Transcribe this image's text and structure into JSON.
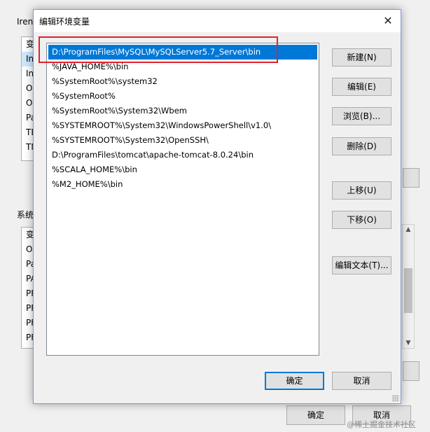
{
  "background": {
    "user_group_label": "Iren",
    "user_rows": [
      "变",
      "In",
      "In",
      "O",
      "O",
      "Pa",
      "TE",
      "TM"
    ],
    "system_group_label": "系统",
    "system_rows": [
      "变",
      "O",
      "Pa",
      "PA",
      "PF",
      "PF",
      "PF",
      "PF"
    ],
    "ok_label": "确定",
    "cancel_label": "取消"
  },
  "dialog": {
    "title": "编辑环境变量",
    "close_glyph": "✕",
    "entries": [
      "D:\\ProgramFiles\\MySQL\\MySQLServer5.7_Server\\bin",
      "%JAVA_HOME%\\bin",
      "%SystemRoot%\\system32",
      "%SystemRoot%",
      "%SystemRoot%\\System32\\Wbem",
      "%SYSTEMROOT%\\System32\\WindowsPowerShell\\v1.0\\",
      "%SYSTEMROOT%\\System32\\OpenSSH\\",
      "D:\\ProgramFiles\\tomcat\\apache-tomcat-8.0.24\\bin",
      "%SCALA_HOME%\\bin",
      "%M2_HOME%\\bin"
    ],
    "selected_index": 0,
    "buttons": {
      "new": "新建(N)",
      "edit": "编辑(E)",
      "browse": "浏览(B)...",
      "delete": "删除(D)",
      "move_up": "上移(U)",
      "move_down": "下移(O)",
      "edit_text": "编辑文本(T)...",
      "ok": "确定",
      "cancel": "取消"
    }
  },
  "watermark": "@稀土掘金技术社区",
  "colors": {
    "selection": "#0078d7",
    "annotation_box": "#e0222e"
  }
}
